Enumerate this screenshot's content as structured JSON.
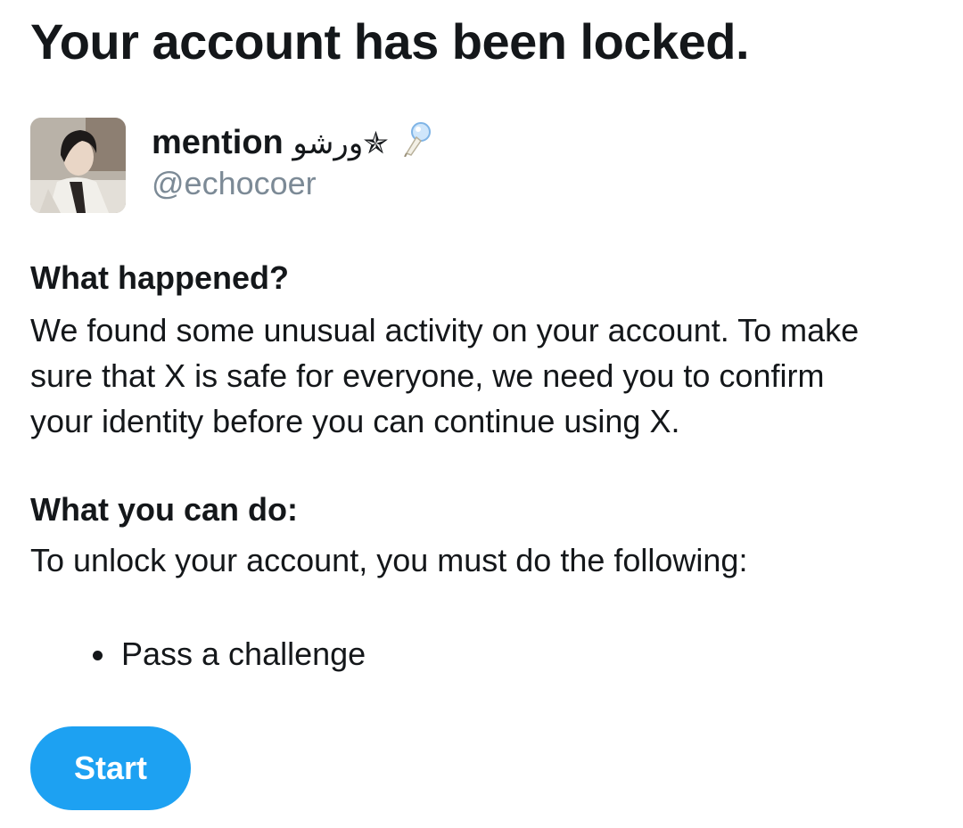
{
  "page": {
    "title": "Your account has been locked."
  },
  "profile": {
    "display_name": "mention",
    "name_decoration": "ورشو✯",
    "handle": "@echocoer",
    "avatar_icon": "user-avatar-photo",
    "pin_icon": "pushpin-icon"
  },
  "what_happened": {
    "heading": "What happened?",
    "body": "We found some unusual activity on your account. To make sure that X is safe for everyone, we need you to confirm your identity before you can continue using X."
  },
  "what_you_can_do": {
    "heading": "What you can do:",
    "body": "To unlock your account, you must do the following:",
    "steps": [
      {
        "label": "Pass a challenge"
      }
    ]
  },
  "actions": {
    "start_label": "Start"
  },
  "colors": {
    "accent": "#1da1f2",
    "text": "#14171a",
    "muted": "#7c8a96"
  }
}
